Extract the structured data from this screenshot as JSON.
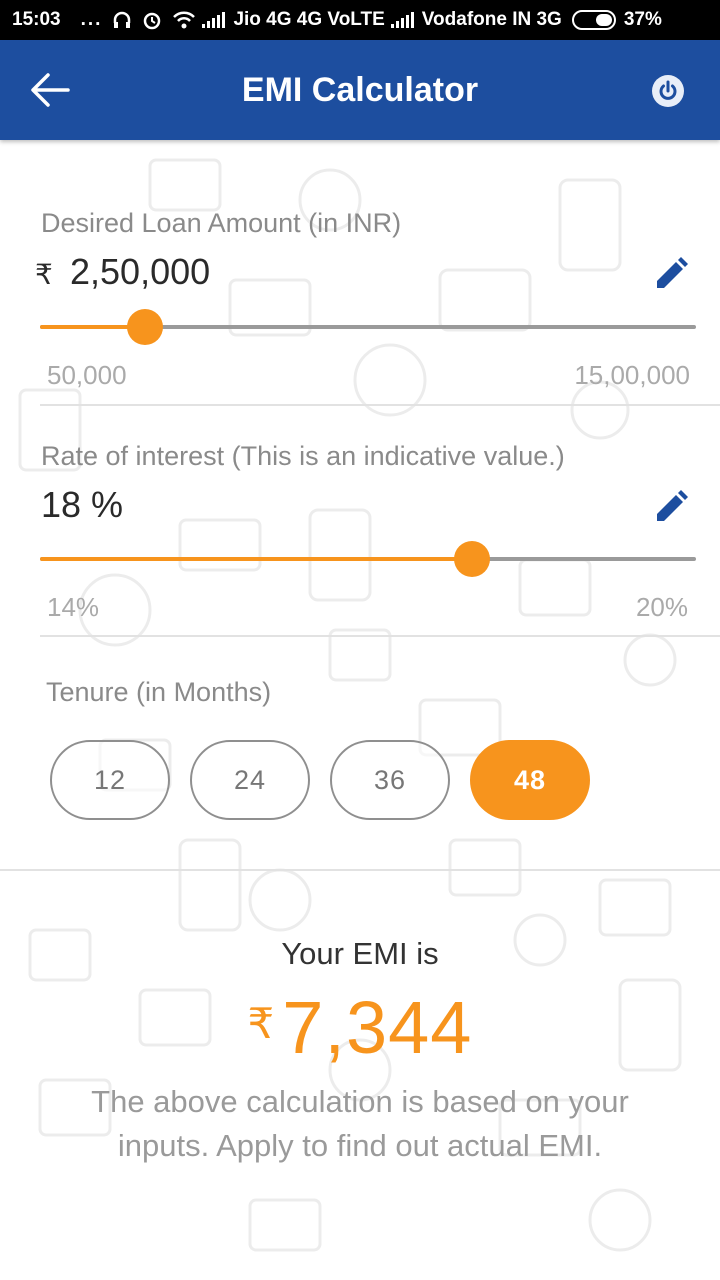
{
  "status_bar": {
    "time": "15:03",
    "dots": "...",
    "carrier1": "Jio 4G 4G VoLTE",
    "carrier2": "Vodafone IN 3G",
    "battery": "37%"
  },
  "app_bar": {
    "title": "EMI Calculator",
    "color": "#1d4e9f"
  },
  "loan": {
    "label": "Desired Loan Amount (in INR)",
    "currency": "₹",
    "value": "2,50,000",
    "min_label": "50,000",
    "max_label": "15,00,000",
    "slider_fraction": 0.16
  },
  "interest": {
    "label": "Rate of interest (This is an indicative value.)",
    "value": "18 %",
    "min_label": "14%",
    "max_label": "20%",
    "slider_fraction": 0.659
  },
  "tenure": {
    "label": "Tenure (in Months)",
    "options": [
      "12",
      "24",
      "36",
      "48"
    ],
    "selected": "48"
  },
  "result": {
    "label": "Your EMI is",
    "currency": "₹",
    "amount": "7,344",
    "note": "The above calculation is based on your inputs. Apply to find out actual EMI."
  },
  "colors": {
    "accent": "#f7941d",
    "primary": "#1d4e9f"
  }
}
